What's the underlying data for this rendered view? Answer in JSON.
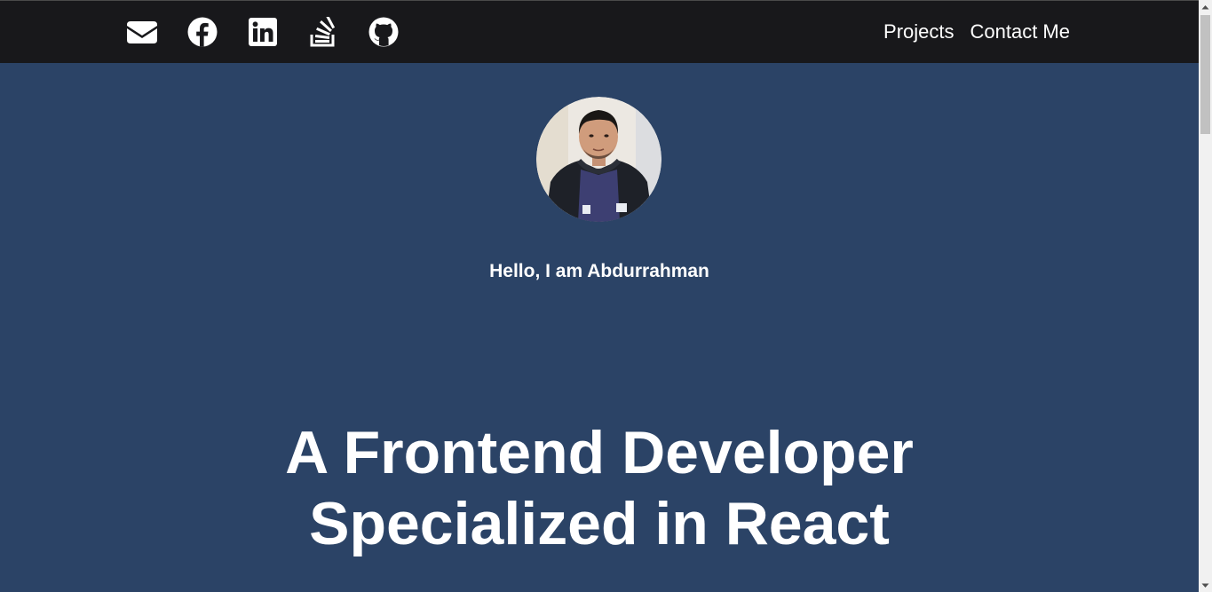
{
  "nav": {
    "social": [
      {
        "icon": "envelope-icon"
      },
      {
        "icon": "facebook-icon"
      },
      {
        "icon": "linkedin-icon"
      },
      {
        "icon": "stackoverflow-icon"
      },
      {
        "icon": "github-icon"
      }
    ],
    "links": {
      "projects": "Projects",
      "contact": "Contact Me"
    }
  },
  "hero": {
    "greeting": "Hello, I am Abdurrahman",
    "headline_line1": "A Frontend Developer",
    "headline_line2": "Specialized in React"
  },
  "colors": {
    "navbar": "#18181b",
    "background": "#2b4366",
    "text": "#ffffff"
  }
}
